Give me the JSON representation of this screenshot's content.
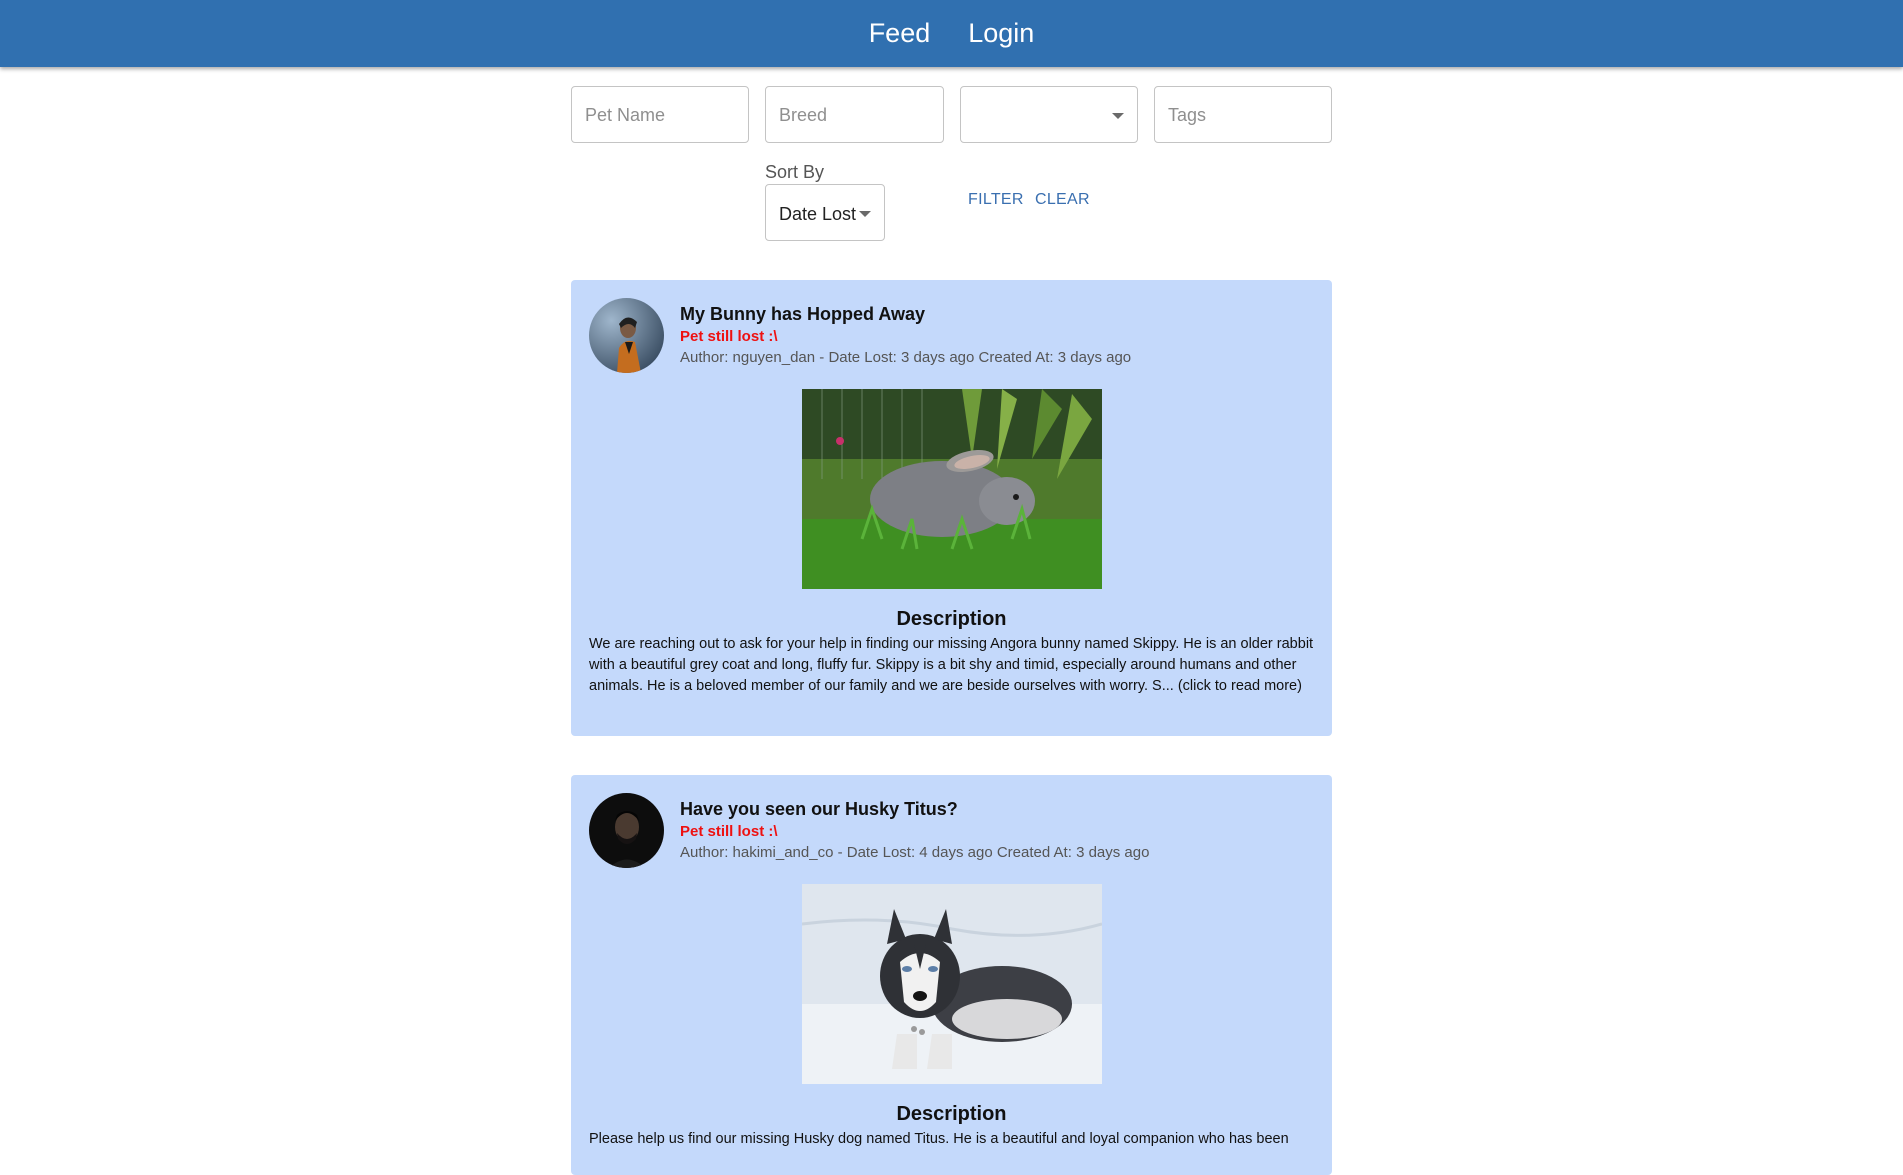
{
  "nav": {
    "feed": "Feed",
    "login": "Login"
  },
  "filters": {
    "pet_name_placeholder": "Pet Name",
    "breed_placeholder": "Breed",
    "type_value": "",
    "tags_placeholder": "Tags"
  },
  "sort": {
    "label": "Sort By",
    "value": "Date Lost"
  },
  "actions": {
    "filter": "FILTER",
    "clear": "CLEAR"
  },
  "colors": {
    "navbar": "#3070b0",
    "card": "#c4d9fb",
    "status": "#ee1111",
    "link": "#3a6fb0"
  },
  "posts": [
    {
      "title": "My Bunny has Hopped Away",
      "status": "Pet still lost :\\",
      "meta": "Author: nguyen_dan - Date Lost: 3 days ago Created At: 3 days ago",
      "desc_heading": "Description",
      "description": "We are reaching out to ask for your help in finding our missing Angora bunny named Skippy. He is an older rabbit with a beautiful grey coat and long, fluffy fur. Skippy is a bit shy and timid, especially around humans and other animals. He is a beloved member of our family and we are beside ourselves with worry. S... (click to read more)"
    },
    {
      "title": "Have you seen our Husky Titus?",
      "status": "Pet still lost :\\",
      "meta": "Author: hakimi_and_co - Date Lost: 4 days ago Created At: 3 days ago",
      "desc_heading": "Description",
      "description": "Please help us find our missing Husky dog named Titus. He is a beautiful and loyal companion who has been"
    }
  ]
}
